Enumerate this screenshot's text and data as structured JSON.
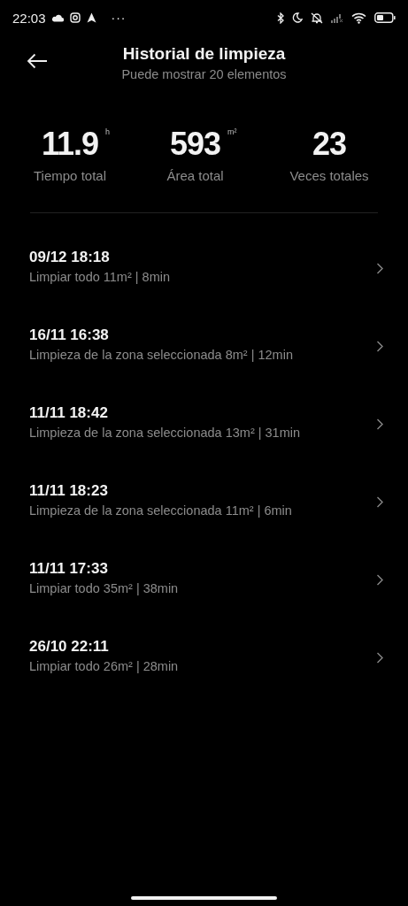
{
  "status_bar": {
    "time": "22:03",
    "more": "···"
  },
  "header": {
    "title": "Historial de limpieza",
    "subtitle": "Puede mostrar 20 elementos"
  },
  "stats": [
    {
      "value": "11.9",
      "unit": "h",
      "label": "Tiempo total"
    },
    {
      "value": "593",
      "unit": "m²",
      "label": "Área total"
    },
    {
      "value": "23",
      "label": "Veces totales"
    }
  ],
  "records": [
    {
      "date": "09/12 18:18",
      "details": "Limpiar todo 11m² | 8min"
    },
    {
      "date": "16/11 16:38",
      "details": "Limpieza de la zona seleccionada 8m² | 12min"
    },
    {
      "date": "11/11 18:42",
      "details": "Limpieza de la zona seleccionada 13m² | 31min"
    },
    {
      "date": "11/11 18:23",
      "details": "Limpieza de la zona seleccionada 11m² | 6min"
    },
    {
      "date": "11/11 17:33",
      "details": "Limpiar todo 35m² | 38min"
    },
    {
      "date": "26/10 22:11",
      "details": "Limpiar todo 26m² | 28min"
    }
  ]
}
